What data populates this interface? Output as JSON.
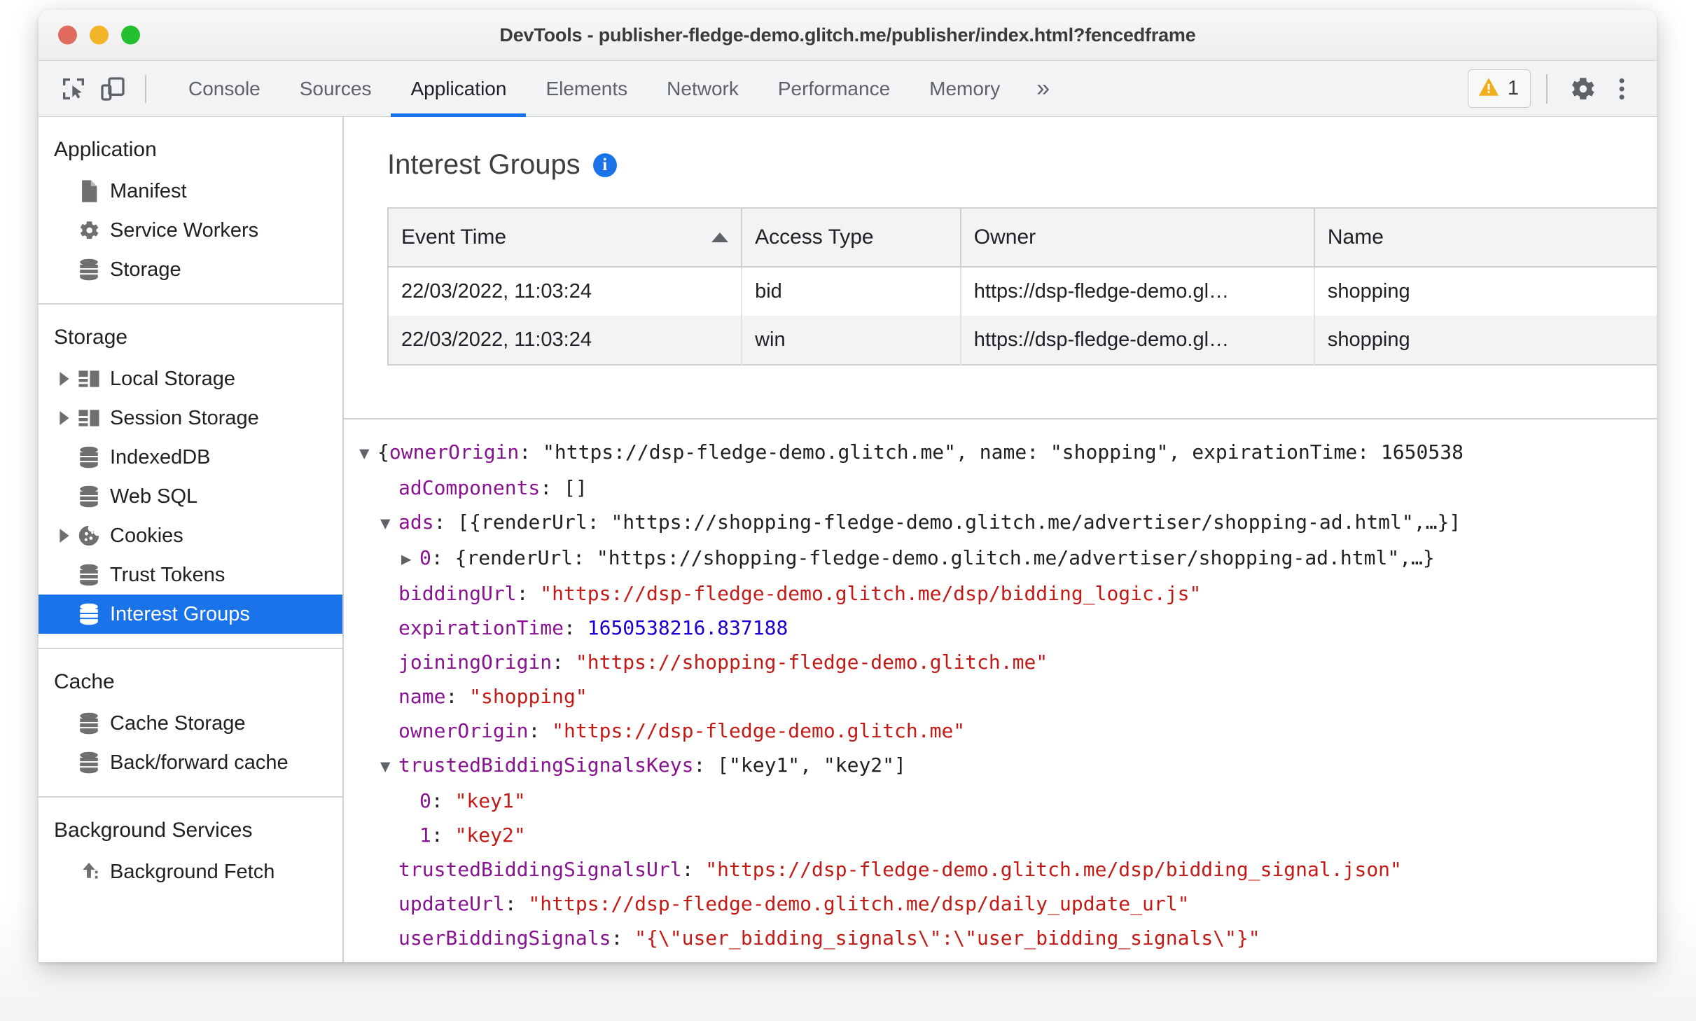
{
  "window": {
    "title": "DevTools - publisher-fledge-demo.glitch.me/publisher/index.html?fencedframe",
    "traffic_lights": [
      "close",
      "minimize",
      "maximize"
    ]
  },
  "toolbar": {
    "inspect_icon": "inspect-cursor-icon",
    "device_icon": "device-toggle-icon",
    "tabs": [
      {
        "label": "Console",
        "active": false
      },
      {
        "label": "Sources",
        "active": false
      },
      {
        "label": "Application",
        "active": true
      },
      {
        "label": "Elements",
        "active": false
      },
      {
        "label": "Network",
        "active": false
      },
      {
        "label": "Performance",
        "active": false
      },
      {
        "label": "Memory",
        "active": false
      }
    ],
    "overflow_label": "»",
    "warning_icon": "warning-triangle-icon",
    "warning_count": "1",
    "settings_icon": "gear-icon",
    "more_icon": "kebab-menu-icon",
    "accent_color": "#1a73e8",
    "warning_color": "#f0ad1e"
  },
  "sidebar": {
    "groups": [
      {
        "title": "Application",
        "items": [
          {
            "label": "Manifest",
            "icon": "document-icon",
            "expandable": false,
            "selected": false
          },
          {
            "label": "Service Workers",
            "icon": "gear-icon",
            "expandable": false,
            "selected": false
          },
          {
            "label": "Storage",
            "icon": "database-icon",
            "expandable": false,
            "selected": false
          }
        ]
      },
      {
        "title": "Storage",
        "items": [
          {
            "label": "Local Storage",
            "icon": "table-icon",
            "expandable": true,
            "selected": false
          },
          {
            "label": "Session Storage",
            "icon": "table-icon",
            "expandable": true,
            "selected": false
          },
          {
            "label": "IndexedDB",
            "icon": "database-icon",
            "expandable": false,
            "selected": false
          },
          {
            "label": "Web SQL",
            "icon": "database-icon",
            "expandable": false,
            "selected": false
          },
          {
            "label": "Cookies",
            "icon": "cookie-icon",
            "expandable": true,
            "selected": false
          },
          {
            "label": "Trust Tokens",
            "icon": "database-icon",
            "expandable": false,
            "selected": false
          },
          {
            "label": "Interest Groups",
            "icon": "database-icon",
            "expandable": false,
            "selected": true
          }
        ]
      },
      {
        "title": "Cache",
        "items": [
          {
            "label": "Cache Storage",
            "icon": "database-icon",
            "expandable": false,
            "selected": false
          },
          {
            "label": "Back/forward cache",
            "icon": "database-icon",
            "expandable": false,
            "selected": false
          }
        ]
      },
      {
        "title": "Background Services",
        "items": [
          {
            "label": "Background Fetch",
            "icon": "upload-arrow-icon",
            "expandable": false,
            "selected": false
          }
        ]
      }
    ],
    "selected_bg": "#1a73e8"
  },
  "main": {
    "panel_title": "Interest Groups",
    "info_glyph": "i",
    "table": {
      "columns": [
        "Event Time",
        "Access Type",
        "Owner",
        "Name"
      ],
      "sorted_column": "Event Time",
      "sort_direction": "ascending",
      "rows": [
        {
          "event_time": "22/03/2022, 11:03:24",
          "access_type": "bid",
          "owner": "https://dsp-fledge-demo.gl…",
          "name": "shopping"
        },
        {
          "event_time": "22/03/2022, 11:03:24",
          "access_type": "win",
          "owner": "https://dsp-fledge-demo.gl…",
          "name": "shopping"
        }
      ]
    },
    "details": {
      "lines": [
        {
          "indent": 0,
          "triangle": "▼",
          "parts": [
            {
              "t": "{",
              "c": "p"
            },
            {
              "t": "ownerOrigin",
              "c": "k"
            },
            {
              "t": ": ",
              "c": "p"
            },
            {
              "t": "\"https://dsp-fledge-demo.glitch.me\"",
              "c": "p"
            },
            {
              "t": ", ",
              "c": "p"
            },
            {
              "t": "name",
              "c": "p"
            },
            {
              "t": ": ",
              "c": "p"
            },
            {
              "t": "\"shopping\"",
              "c": "p"
            },
            {
              "t": ", ",
              "c": "p"
            },
            {
              "t": "expirationTime",
              "c": "p"
            },
            {
              "t": ": ",
              "c": "p"
            },
            {
              "t": "1650538",
              "c": "p"
            }
          ]
        },
        {
          "indent": 1,
          "triangle": "",
          "parts": [
            {
              "t": "adComponents",
              "c": "k"
            },
            {
              "t": ": []",
              "c": "p"
            }
          ]
        },
        {
          "indent": 1,
          "triangle": "▼",
          "parts": [
            {
              "t": "ads",
              "c": "k"
            },
            {
              "t": ": [{",
              "c": "p"
            },
            {
              "t": "renderUrl",
              "c": "p"
            },
            {
              "t": ": ",
              "c": "p"
            },
            {
              "t": "\"https://shopping-fledge-demo.glitch.me/advertiser/shopping-ad.html\"",
              "c": "p"
            },
            {
              "t": ",…}]",
              "c": "p"
            }
          ]
        },
        {
          "indent": 2,
          "triangle": "▶",
          "parts": [
            {
              "t": "0",
              "c": "k"
            },
            {
              "t": ": {",
              "c": "p"
            },
            {
              "t": "renderUrl",
              "c": "p"
            },
            {
              "t": ": ",
              "c": "p"
            },
            {
              "t": "\"https://shopping-fledge-demo.glitch.me/advertiser/shopping-ad.html\"",
              "c": "p"
            },
            {
              "t": ",…}",
              "c": "p"
            }
          ]
        },
        {
          "indent": 1,
          "triangle": "",
          "parts": [
            {
              "t": "biddingUrl",
              "c": "k"
            },
            {
              "t": ": ",
              "c": "p"
            },
            {
              "t": "\"https://dsp-fledge-demo.glitch.me/dsp/bidding_logic.js\"",
              "c": "s"
            }
          ]
        },
        {
          "indent": 1,
          "triangle": "",
          "parts": [
            {
              "t": "expirationTime",
              "c": "k"
            },
            {
              "t": ": ",
              "c": "p"
            },
            {
              "t": "1650538216.837188",
              "c": "n"
            }
          ]
        },
        {
          "indent": 1,
          "triangle": "",
          "parts": [
            {
              "t": "joiningOrigin",
              "c": "k"
            },
            {
              "t": ": ",
              "c": "p"
            },
            {
              "t": "\"https://shopping-fledge-demo.glitch.me\"",
              "c": "s"
            }
          ]
        },
        {
          "indent": 1,
          "triangle": "",
          "parts": [
            {
              "t": "name",
              "c": "k"
            },
            {
              "t": ": ",
              "c": "p"
            },
            {
              "t": "\"shopping\"",
              "c": "s"
            }
          ]
        },
        {
          "indent": 1,
          "triangle": "",
          "parts": [
            {
              "t": "ownerOrigin",
              "c": "k"
            },
            {
              "t": ": ",
              "c": "p"
            },
            {
              "t": "\"https://dsp-fledge-demo.glitch.me\"",
              "c": "s"
            }
          ]
        },
        {
          "indent": 1,
          "triangle": "▼",
          "parts": [
            {
              "t": "trustedBiddingSignalsKeys",
              "c": "k"
            },
            {
              "t": ": [\"key1\", \"key2\"]",
              "c": "p"
            }
          ]
        },
        {
          "indent": 2,
          "triangle": "",
          "parts": [
            {
              "t": "0",
              "c": "k"
            },
            {
              "t": ": ",
              "c": "p"
            },
            {
              "t": "\"key1\"",
              "c": "s"
            }
          ]
        },
        {
          "indent": 2,
          "triangle": "",
          "parts": [
            {
              "t": "1",
              "c": "k"
            },
            {
              "t": ": ",
              "c": "p"
            },
            {
              "t": "\"key2\"",
              "c": "s"
            }
          ]
        },
        {
          "indent": 1,
          "triangle": "",
          "parts": [
            {
              "t": "trustedBiddingSignalsUrl",
              "c": "k"
            },
            {
              "t": ": ",
              "c": "p"
            },
            {
              "t": "\"https://dsp-fledge-demo.glitch.me/dsp/bidding_signal.json\"",
              "c": "s"
            }
          ]
        },
        {
          "indent": 1,
          "triangle": "",
          "parts": [
            {
              "t": "updateUrl",
              "c": "k"
            },
            {
              "t": ": ",
              "c": "p"
            },
            {
              "t": "\"https://dsp-fledge-demo.glitch.me/dsp/daily_update_url\"",
              "c": "s"
            }
          ]
        },
        {
          "indent": 1,
          "triangle": "",
          "parts": [
            {
              "t": "userBiddingSignals",
              "c": "k"
            },
            {
              "t": ": ",
              "c": "p"
            },
            {
              "t": "\"{\\\"user_bidding_signals\\\":\\\"user_bidding_signals\\\"}\"",
              "c": "s"
            }
          ]
        }
      ],
      "colors": {
        "key": "#881391",
        "string": "#c41a16",
        "number": "#1c00cf",
        "plain": "#202124"
      }
    }
  }
}
